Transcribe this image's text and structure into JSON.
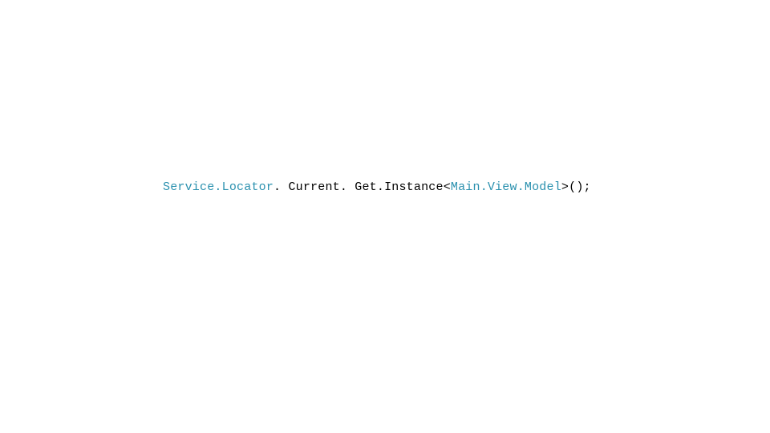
{
  "code": {
    "token1": "Service.Locator",
    "dot1": ". ",
    "token2": "Current",
    "dot2": ". ",
    "token3": "Get.Instance",
    "lt": "<",
    "token4": "Main.View.Model",
    "gt": ">",
    "parens": "();"
  }
}
